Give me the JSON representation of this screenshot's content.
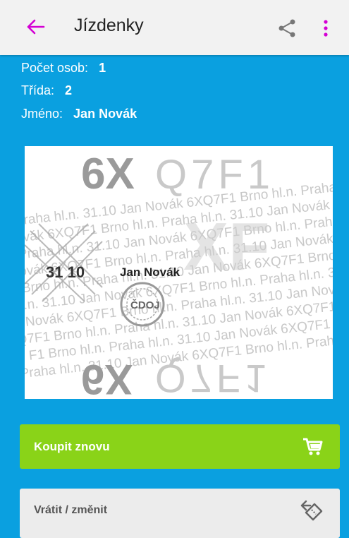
{
  "appbar": {
    "title": "Jízdenky"
  },
  "info": {
    "persons_label": "Počet osob:",
    "persons_value": "1",
    "class_label": "Třída:",
    "class_value": "2",
    "name_label": "Jméno:",
    "name_value": "Jan Novák"
  },
  "ticket": {
    "code_top": "6X",
    "code_top_light": "Q7F1",
    "code_bottom": "6X",
    "code_bottom_light": "Q7F1",
    "date": "31 10",
    "passenger": "Jan Novák",
    "stamp": "ČDOJ",
    "pattern_lines": [
      "Praha hl.n. 31.10 Jan Novák 6XQ7F1 Brno hl.n. Praha hl.n. 31.10",
      "Novák 6XQ7F1 Brno hl.n. Praha hl.n. 31.10 Jan Novák 6XQ7F1 Brno",
      "Praha hl.n. 31.10 Jan Novák 6XQ7F1 Brno hl.n. Praha hl.n. 31.10",
      "Novák 6XQ7F1 Brno hl.n. Praha hl.n. 31.10 Jan Novák 6XQ7F1",
      "Brno hl.n. Praha hl.n. 31.10 Jan Novák 6XQ7F1 Brno hl.n. Praha",
      "hl.n. 31.10 Jan Novák 6XQ7F1 Brno hl.n. Praha hl.n. 31.10 Jan",
      "Novák 6XQ7F1 Brno hl.n. Praha hl.n. 31.10 Jan Novák 6XQ7F1",
      "Q7F1 Brno hl.n. Praha hl.n. 31.10 Jan Novák 6XQ7F1 Brno hl.n.",
      "F1 Brno hl.n. Praha hl.n. 31.10 Jan Novák 6XQ7F1 Brno hl.n.",
      "Praha hl.n. 31.10 Jan Novák 6XQ7F1 Brno hl.n. Praha hl.n. 31.10 Ja"
    ]
  },
  "buttons": {
    "buy_label": "Koupit znovu",
    "return_label": "Vrátit / změnit"
  },
  "colors": {
    "accent": "#d400d4",
    "background": "#0aa0e0",
    "buy": "#8ad318"
  }
}
